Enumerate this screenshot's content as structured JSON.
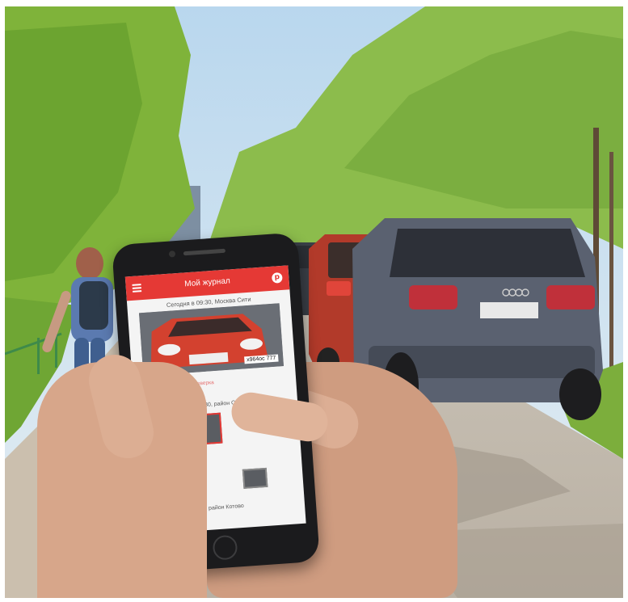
{
  "app": {
    "title": "Мой журнал",
    "menu_icon": "hamburger-menu-icon",
    "logo_icon": "app-logo-icon",
    "accent_color": "#e53935"
  },
  "feed": {
    "first": {
      "date": "Сегодня в 09:30, Москва Сити",
      "plate": "х964ос",
      "region": "777",
      "note": "Упорядочивание и Проверка"
    },
    "second": {
      "date": "Вчера в 17:30, район Солнцево"
    },
    "third": {
      "date": "... район Котово"
    }
  }
}
